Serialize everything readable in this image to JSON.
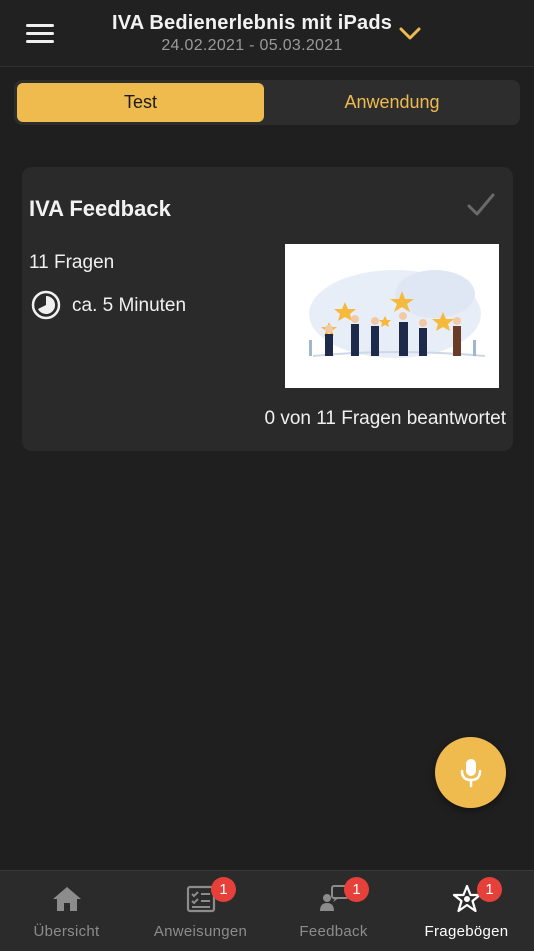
{
  "header": {
    "title": "IVA Bedienerlebnis mit iPads",
    "dates": "24.02.2021 - 05.03.2021"
  },
  "segments": {
    "active_label": "Test",
    "inactive_label": "Anwendung"
  },
  "card": {
    "title": "IVA Feedback",
    "questions": "11 Fragen",
    "duration": "ca. 5 Minuten",
    "progress": "0 von 11 Fragen beantwortet"
  },
  "tabs": [
    {
      "label": "Übersicht",
      "icon": "home-icon",
      "badge": null,
      "active": false
    },
    {
      "label": "Anweisungen",
      "icon": "checklist-icon",
      "badge": "1",
      "active": false
    },
    {
      "label": "Feedback",
      "icon": "feedback-icon",
      "badge": "1",
      "active": false
    },
    {
      "label": "Fragebögen",
      "icon": "star-icon",
      "badge": "1",
      "active": true
    }
  ],
  "colors": {
    "accent": "#efbb4f",
    "background": "#1f1f1f",
    "card": "#2a2a2a",
    "badge": "#e5413a"
  }
}
